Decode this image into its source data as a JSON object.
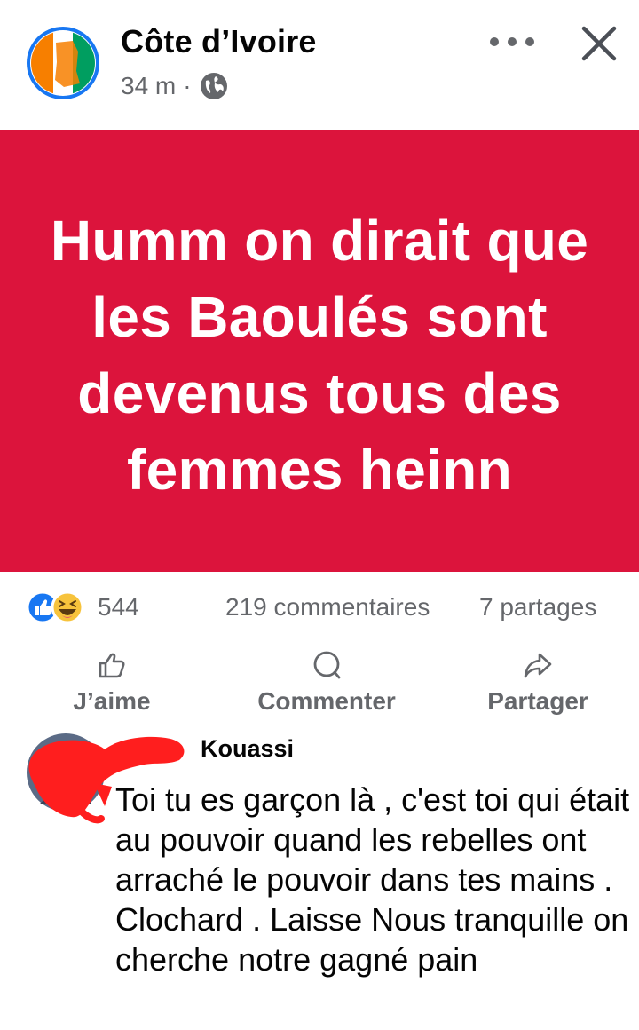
{
  "header": {
    "page_name": "Côte d’Ivoire",
    "time": "34 m",
    "separator": "·",
    "audience_icon": "globe-icon",
    "flag_colors": [
      "#f77f00",
      "#ffffff",
      "#009e60"
    ],
    "ring_color": "#1877f2"
  },
  "post": {
    "background": "#dc143c",
    "text": "Humm on dirait que les Baoulés sont devenus tous des femmes heinn"
  },
  "stats": {
    "reactions": [
      "like-icon",
      "haha-icon"
    ],
    "reaction_count": "544",
    "comments": "219 commentaires",
    "shares": "7 partages"
  },
  "actions": {
    "like": "J’aime",
    "comment": "Commenter",
    "share": "Partager"
  },
  "comment": {
    "author": "Kouassi",
    "text": "Toi tu es garçon là , c'est toi qui était au pouvoir quand les rebelles ont arraché le pouvoir dans tes mains . Clochard . Laisse Nous tranquille on cherche notre gagné pain"
  },
  "colors": {
    "muted": "#65676b",
    "redaction": "#ff1e1e"
  }
}
